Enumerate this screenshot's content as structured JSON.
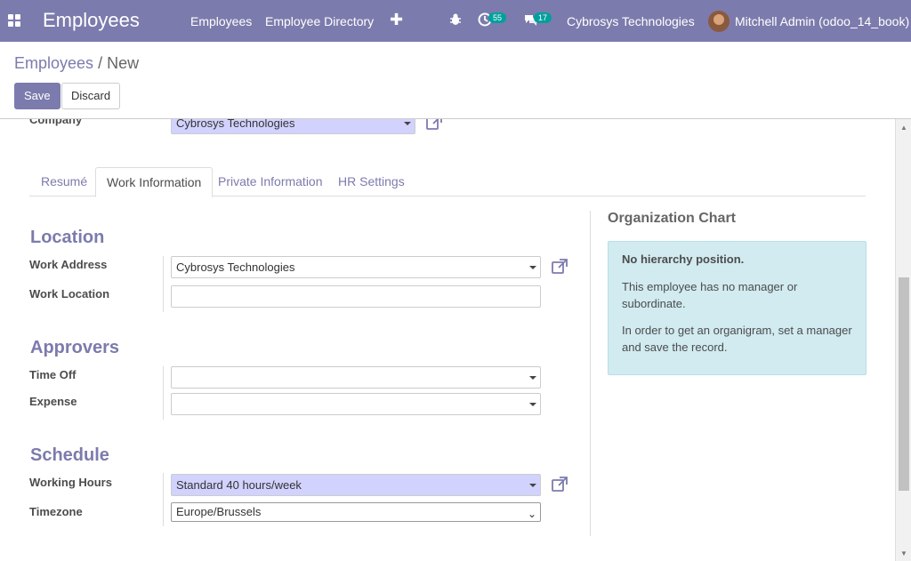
{
  "navbar": {
    "app_title": "Employees",
    "menu": [
      "Employees",
      "Employee Directory"
    ],
    "activity_count": "55",
    "message_count": "17",
    "company": "Cybrosys Technologies",
    "user": "Mitchell Admin (odoo_14_book)"
  },
  "breadcrumb": {
    "parent": "Employees",
    "separator": "/",
    "current": "New"
  },
  "buttons": {
    "save": "Save",
    "discard": "Discard"
  },
  "form": {
    "company_label": "Company",
    "company_value": "Cybrosys Technologies",
    "tabs": [
      "Resumé",
      "Work Information",
      "Private Information",
      "HR Settings"
    ],
    "active_tab": "Work Information",
    "location": {
      "title": "Location",
      "work_address_label": "Work Address",
      "work_address_value": "Cybrosys Technologies",
      "work_location_label": "Work Location",
      "work_location_value": ""
    },
    "approvers": {
      "title": "Approvers",
      "time_off_label": "Time Off",
      "time_off_value": "",
      "expense_label": "Expense",
      "expense_value": ""
    },
    "schedule": {
      "title": "Schedule",
      "working_hours_label": "Working Hours",
      "working_hours_value": "Standard 40 hours/week",
      "timezone_label": "Timezone",
      "timezone_value": "Europe/Brussels"
    }
  },
  "org_chart": {
    "title": "Organization Chart",
    "heading": "No hierarchy position.",
    "line1": "This employee has no manager or subordinate.",
    "line2": "In order to get an organigram, set a manager and save the record."
  },
  "colors": {
    "primary": "#7c7bad",
    "required_field": "#d2d2ff",
    "info_box": "#d1ebf0",
    "badge": "#00a09d"
  }
}
